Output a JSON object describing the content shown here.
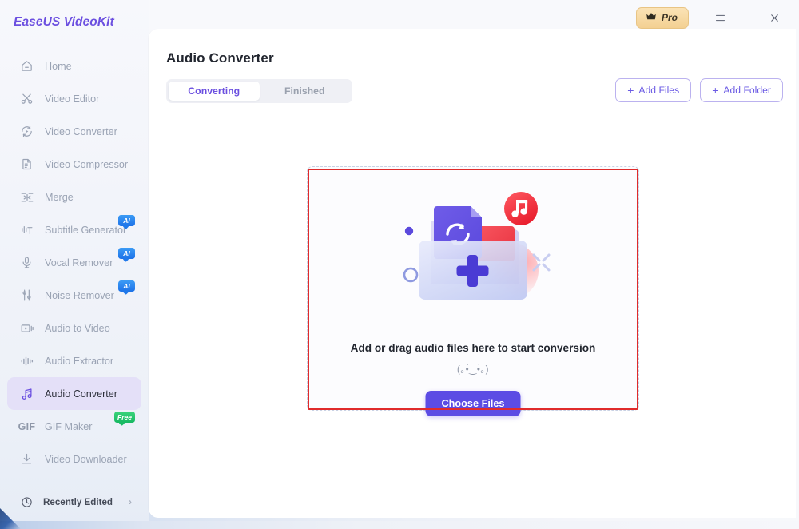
{
  "app": {
    "logo": "EaseUS VideoKit"
  },
  "titlebar": {
    "pro_label": "Pro",
    "crown_icon": "crown-icon",
    "menu_icon": "hamburger-menu-icon",
    "minimize_icon": "minimize-icon",
    "close_icon": "close-icon"
  },
  "sidebar": {
    "items": [
      {
        "label": "Home",
        "icon": "home-icon",
        "badge": null,
        "active": false
      },
      {
        "label": "Video Editor",
        "icon": "scissors-icon",
        "badge": null,
        "active": false
      },
      {
        "label": "Video Converter",
        "icon": "convert-play-icon",
        "badge": null,
        "active": false
      },
      {
        "label": "Video Compressor",
        "icon": "document-icon",
        "badge": null,
        "active": false
      },
      {
        "label": "Merge",
        "icon": "merge-arrows-icon",
        "badge": null,
        "active": false
      },
      {
        "label": "Subtitle Generator",
        "icon": "subtitle-icon",
        "badge": "AI",
        "active": false
      },
      {
        "label": "Vocal Remover",
        "icon": "microphone-icon",
        "badge": "AI",
        "active": false
      },
      {
        "label": "Noise Remover",
        "icon": "sliders-icon",
        "badge": "AI",
        "active": false
      },
      {
        "label": "Audio to Video",
        "icon": "video-camera-icon",
        "badge": null,
        "active": false
      },
      {
        "label": "Audio Extractor",
        "icon": "waveform-icon",
        "badge": null,
        "active": false
      },
      {
        "label": "Audio Converter",
        "icon": "music-note-icon",
        "badge": null,
        "active": true
      },
      {
        "label": "GIF Maker",
        "icon": "gif-text-icon",
        "badge": "Free",
        "active": false
      },
      {
        "label": "Video Downloader",
        "icon": "download-icon",
        "badge": null,
        "active": false
      }
    ],
    "recently_edited": {
      "label": "Recently Edited",
      "icon": "clock-icon",
      "chevron": "›"
    }
  },
  "main": {
    "page_title": "Audio Converter",
    "tabs": [
      {
        "label": "Converting",
        "active": true
      },
      {
        "label": "Finished",
        "active": false
      }
    ],
    "actions": [
      {
        "label": "Add Files",
        "icon": "plus-icon"
      },
      {
        "label": "Add Folder",
        "icon": "plus-icon"
      }
    ],
    "dropzone": {
      "illustration": "folder-music-convert-illustration",
      "title": "Add or drag audio files here to start conversion",
      "emoticon": "(｡•́‿•̀｡)",
      "button_label": "Choose Files"
    }
  },
  "colors": {
    "accent_purple": "#6b4fe0",
    "button_purple": "#5c4ce4",
    "active_item_bg": "#e4e0f8",
    "badge_ai_blue": "#1d72e8",
    "badge_free_green": "#16b862",
    "pro_gold": "#f3d092",
    "highlight_red": "#e02b2b",
    "text_dark": "#22262f",
    "text_muted": "#9aa3b4"
  }
}
